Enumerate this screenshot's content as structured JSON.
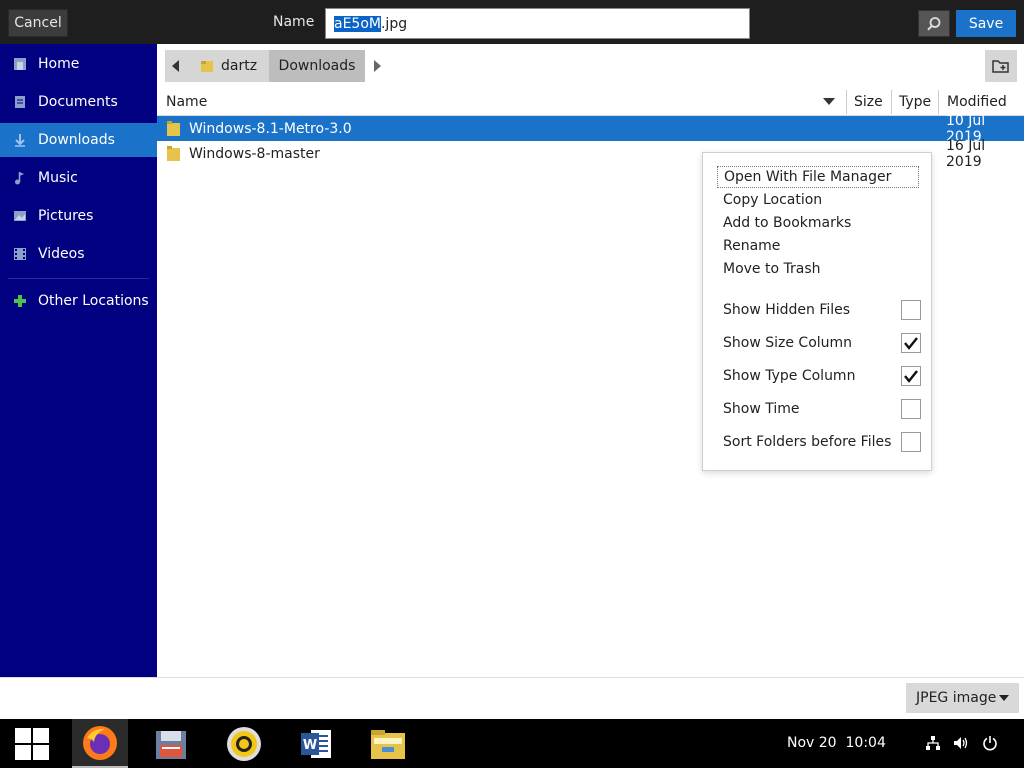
{
  "header": {
    "cancel_label": "Cancel",
    "name_label": "Name",
    "filename_selected": "aE5oM",
    "filename_ext": ".jpg",
    "save_label": "Save"
  },
  "sidebar": {
    "items": [
      {
        "label": "Home",
        "icon": "home-icon"
      },
      {
        "label": "Documents",
        "icon": "documents-icon"
      },
      {
        "label": "Downloads",
        "icon": "downloads-icon",
        "active": true
      },
      {
        "label": "Music",
        "icon": "music-icon"
      },
      {
        "label": "Pictures",
        "icon": "pictures-icon"
      },
      {
        "label": "Videos",
        "icon": "videos-icon"
      },
      {
        "label": "Other Locations",
        "icon": "plus-icon"
      }
    ]
  },
  "pathbar": {
    "crumbs": [
      "dartz",
      "Downloads"
    ]
  },
  "filelist": {
    "columns": {
      "name": "Name",
      "size": "Size",
      "type": "Type",
      "modified": "Modified"
    },
    "rows": [
      {
        "name": "Windows-8.1-Metro-3.0",
        "modified": "10 Jul 2019",
        "selected": true
      },
      {
        "name": "Windows-8-master",
        "modified": "16 Jul 2019",
        "selected": false
      }
    ]
  },
  "context_menu": {
    "actions": [
      "Open With File Manager",
      "Copy Location",
      "Add to Bookmarks",
      "Rename",
      "Move to Trash"
    ],
    "toggles": [
      {
        "label": "Show Hidden Files",
        "checked": false
      },
      {
        "label": "Show Size Column",
        "checked": true
      },
      {
        "label": "Show Type Column",
        "checked": true
      },
      {
        "label": "Show Time",
        "checked": false
      },
      {
        "label": "Sort Folders before Files",
        "checked": false
      }
    ]
  },
  "filter": {
    "selected": "JPEG image"
  },
  "taskbar": {
    "apps": [
      "start-icon",
      "firefox-icon",
      "save-disk-icon",
      "media-player-icon",
      "word-icon",
      "file-explorer-icon"
    ],
    "clock_date": "Nov 20",
    "clock_time": "10:04"
  },
  "colors": {
    "sidebar_bg": "#000080",
    "accent": "#1a73c9",
    "header_bg": "#1e1e1e"
  }
}
